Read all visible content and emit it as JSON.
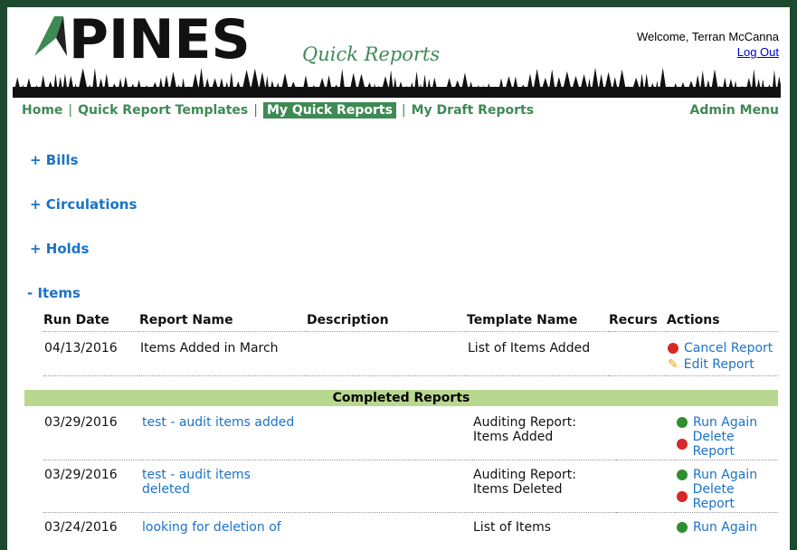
{
  "header": {
    "logo_text": "PINES",
    "subtitle": "Quick Reports",
    "welcome": "Welcome, Terran McCanna",
    "logout": "Log Out"
  },
  "nav": {
    "home": "Home",
    "templates": "Quick Report Templates",
    "my_reports": "My Quick Reports",
    "drafts": "My Draft Reports",
    "admin": "Admin Menu"
  },
  "sections": {
    "bills": "+ Bills",
    "circulations": "+ Circulations",
    "holds": "+ Holds",
    "items": "- Items"
  },
  "table": {
    "headers": [
      "Run Date",
      "Report Name",
      "Description",
      "Template Name",
      "Recurs",
      "Actions"
    ],
    "scheduled": {
      "run_date": "04/13/2016",
      "name": "Items Added in March",
      "template": "List of Items Added",
      "cancel": "Cancel Report",
      "edit": "Edit Report"
    },
    "completed_label": "Completed Reports",
    "completed": [
      {
        "run_date": "03/29/2016",
        "name_1": "test - audit items added",
        "name_2": "",
        "template_1": "Auditing Report:",
        "template_2": "Items Added",
        "run": "Run Again",
        "delete": "Delete Report"
      },
      {
        "run_date": "03/29/2016",
        "name_1": "test - audit items",
        "name_2": "deleted",
        "template_1": "Auditing Report:",
        "template_2": "Items Deleted",
        "run": "Run Again",
        "delete": "Delete Report"
      },
      {
        "run_date": "03/24/2016",
        "name_1": "looking for deletion of",
        "name_2": "",
        "template_1": "List of Items",
        "template_2": "",
        "run": "Run Again",
        "delete": ""
      }
    ]
  }
}
